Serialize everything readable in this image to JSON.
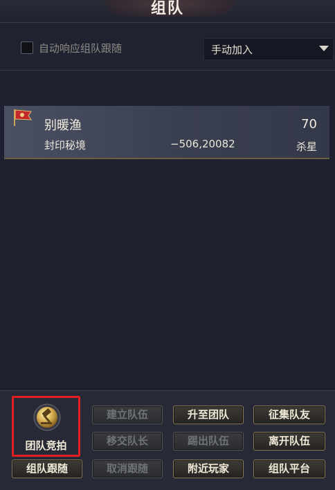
{
  "window": {
    "title": "组队"
  },
  "options": {
    "auto_follow_label": "自动响应组队跟随",
    "auto_follow_checked": false,
    "join_mode": "手动加入"
  },
  "team": {
    "members": [
      {
        "name": "别暖渔",
        "level": "70",
        "map": "封印秘境",
        "coords": "−506,20082",
        "role": "杀星",
        "icon": "flag-icon"
      }
    ]
  },
  "actions": {
    "auction_label": "团队竞拍",
    "auction_icon": "gavel-icon",
    "highlight_color": "#e02020",
    "buttons": {
      "create_team": "建立队伍",
      "upgrade_team": "升至团队",
      "recruit": "征集队友",
      "transfer_leader": "移交队长",
      "kick_member": "踢出队伍",
      "leave_team": "离开队伍",
      "team_follow": "组队跟随",
      "cancel_follow": "取消跟随",
      "nearby_players": "附近玩家",
      "team_platform": "组队平台"
    }
  }
}
